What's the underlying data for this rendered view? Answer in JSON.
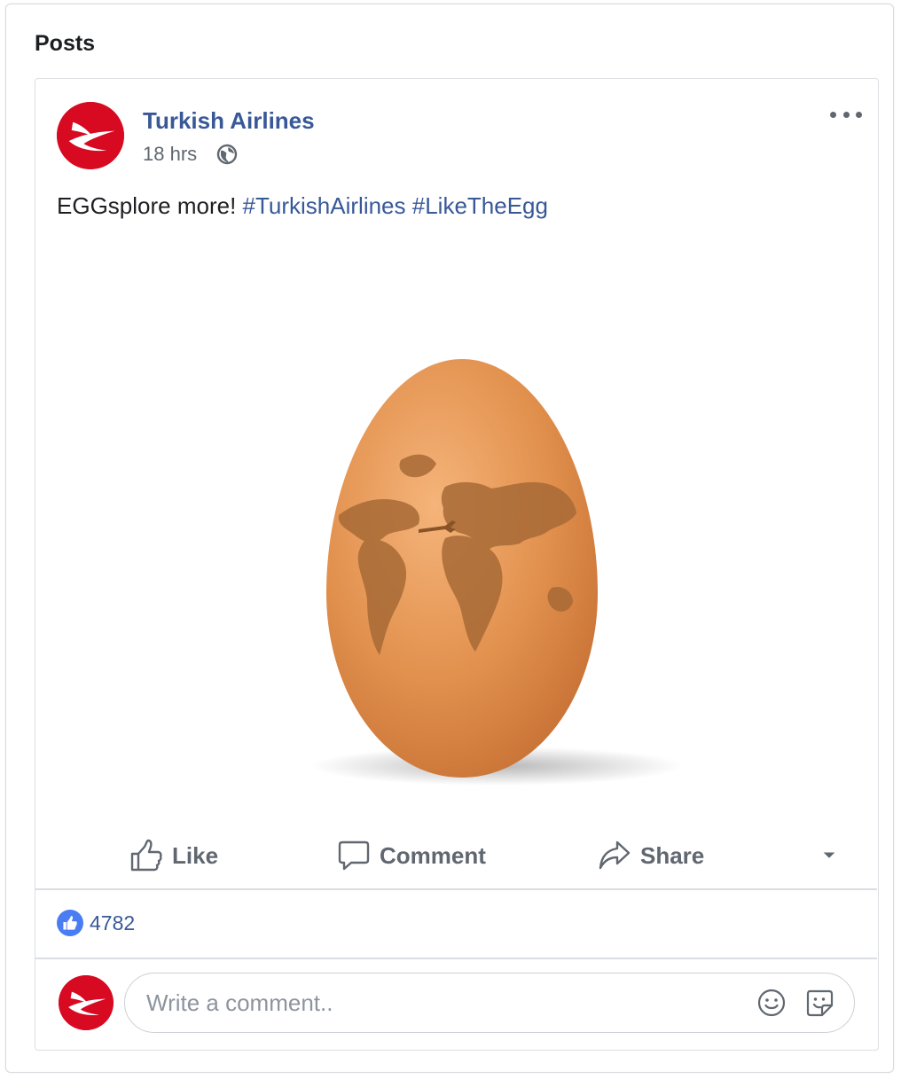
{
  "section": {
    "title": "Posts"
  },
  "post": {
    "page_name": "Turkish Airlines",
    "timestamp": "18 hrs",
    "privacy_icon": "globe-icon",
    "text_main": "EGGsplore more!",
    "hashtags": [
      "#TurkishAirlines",
      "#LikeTheEgg"
    ],
    "image_subject": "egg-with-world-map-and-plane"
  },
  "actions": {
    "like": "Like",
    "comment": "Comment",
    "share": "Share"
  },
  "reactions": {
    "like_count": "4782"
  },
  "comment_box": {
    "placeholder": "Write a comment.."
  },
  "colors": {
    "brand_red": "#d70a22",
    "link_blue": "#385898",
    "like_blue": "#4a7cf2",
    "muted_gray": "#606770"
  }
}
